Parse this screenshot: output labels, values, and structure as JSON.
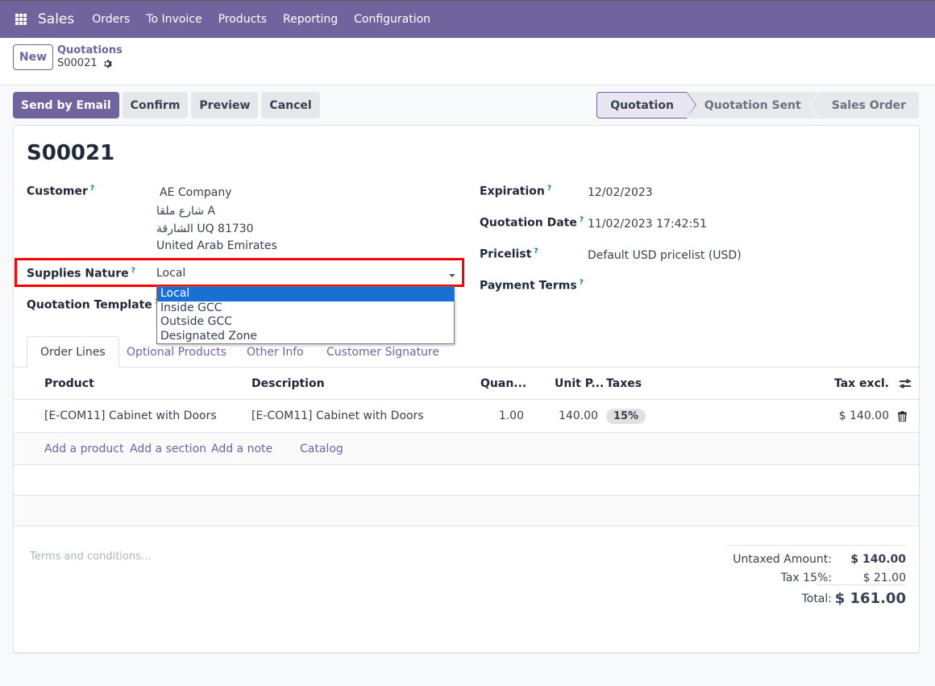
{
  "navbar": {
    "app_name": "Sales",
    "menus": [
      "Orders",
      "To Invoice",
      "Products",
      "Reporting",
      "Configuration"
    ]
  },
  "control_panel": {
    "new_label": "New",
    "breadcrumb_parent": "Quotations",
    "breadcrumb_current": "S00021"
  },
  "actions": {
    "send_email": "Send by Email",
    "confirm": "Confirm",
    "preview": "Preview",
    "cancel": "Cancel"
  },
  "stages": [
    {
      "label": "Quotation",
      "active": true
    },
    {
      "label": "Quotation Sent",
      "active": false
    },
    {
      "label": "Sales Order",
      "active": false
    }
  ],
  "form": {
    "title": "S00021",
    "help_mark": "?",
    "customer": {
      "label": "Customer",
      "name": "AE Company",
      "address_line1": "شارع ملقا A",
      "address_line2": "الشارقة UQ 81730",
      "country": "United Arab Emirates"
    },
    "supplies_nature": {
      "label": "Supplies Nature",
      "value": "Local",
      "options": [
        "Local",
        "Inside GCC",
        "Outside GCC",
        "Designated Zone"
      ],
      "selected_index": 0
    },
    "quotation_template": {
      "label": "Quotation Template",
      "value": ""
    },
    "expiration": {
      "label": "Expiration",
      "value": "12/02/2023"
    },
    "quotation_date": {
      "label": "Quotation Date",
      "value": "11/02/2023 17:42:51"
    },
    "pricelist": {
      "label": "Pricelist",
      "value": "Default USD pricelist (USD)"
    },
    "payment_terms": {
      "label": "Payment Terms",
      "value": ""
    }
  },
  "tabs": [
    {
      "label": "Order Lines",
      "active": true
    },
    {
      "label": "Optional Products",
      "active": false
    },
    {
      "label": "Other Info",
      "active": false
    },
    {
      "label": "Customer Signature",
      "active": false
    }
  ],
  "order_lines": {
    "columns": [
      "Product",
      "Description",
      "Quan...",
      "Unit P...",
      "Taxes",
      "Tax excl."
    ],
    "rows": [
      {
        "product": "[E-COM11] Cabinet with Doors",
        "description": "[E-COM11] Cabinet with Doors",
        "quantity": "1.00",
        "unit_price": "140.00",
        "taxes": "15%",
        "subtotal": "$ 140.00"
      }
    ],
    "add_links": {
      "product": "Add a product",
      "section": "Add a section",
      "note": "Add a note",
      "catalog": "Catalog"
    }
  },
  "terms_placeholder": "Terms and conditions...",
  "totals": {
    "untaxed_label": "Untaxed Amount:",
    "untaxed_value": "$ 140.00",
    "tax_label": "Tax 15%:",
    "tax_value": "$ 21.00",
    "total_label": "Total:",
    "total_value": "$ 161.00"
  },
  "colors": {
    "brand": "#71639e",
    "highlight_box": "#ff0000",
    "selected_option": "#1a6fd4",
    "help_mark": "#017e84"
  }
}
